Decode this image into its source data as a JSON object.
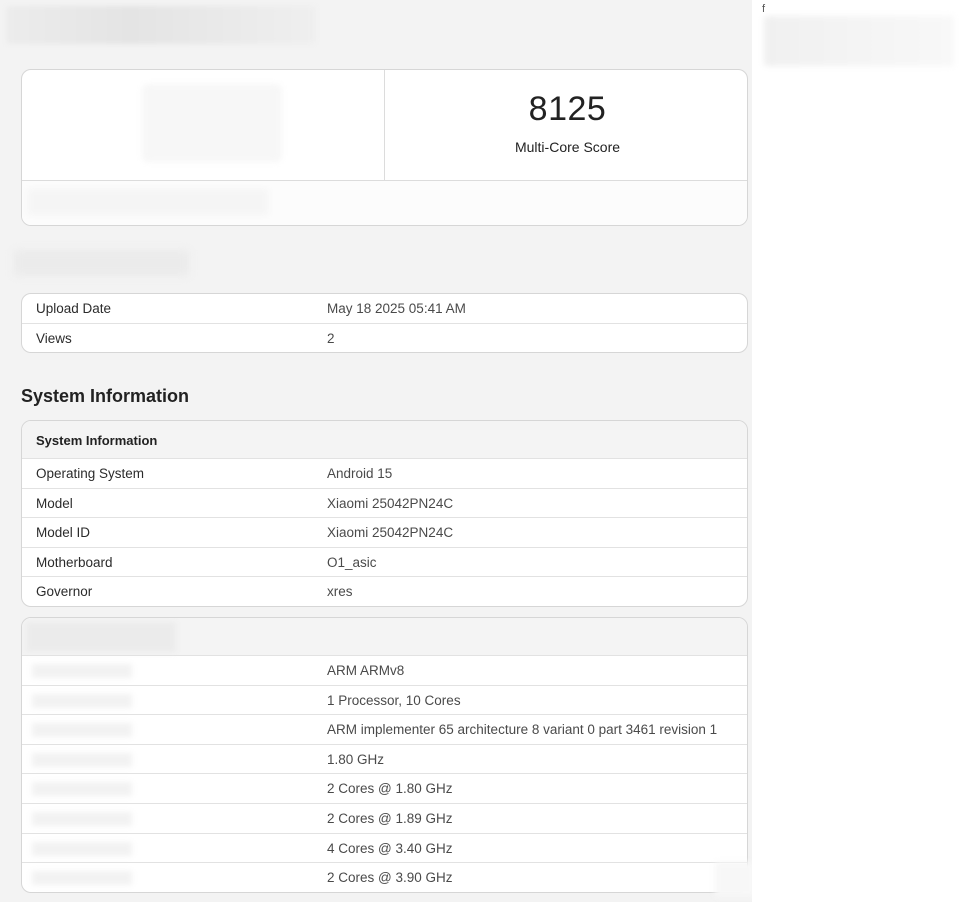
{
  "score": {
    "value": "8125",
    "label": "Multi-Core Score"
  },
  "meta": {
    "rows": [
      {
        "key": "Upload Date",
        "value": "May 18 2025 05:41 AM"
      },
      {
        "key": "Views",
        "value": "2"
      }
    ]
  },
  "system_information": {
    "section_title": "System Information",
    "card_title": "System Information",
    "rows": [
      {
        "key": "Operating System",
        "value": "Android 15"
      },
      {
        "key": "Model",
        "value": "Xiaomi 25042PN24C"
      },
      {
        "key": "Model ID",
        "value": "Xiaomi 25042PN24C"
      },
      {
        "key": "Motherboard",
        "value": "O1_asic"
      },
      {
        "key": "Governor",
        "value": "xres"
      }
    ]
  },
  "cpu_information": {
    "rows": [
      {
        "value": "ARM ARMv8"
      },
      {
        "value": "1 Processor, 10 Cores"
      },
      {
        "value": "ARM implementer 65 architecture 8 variant 0 part 3461 revision 1"
      },
      {
        "value": "1.80 GHz"
      },
      {
        "value": "2 Cores @ 1.80 GHz"
      },
      {
        "value": "2 Cores @ 1.89 GHz"
      },
      {
        "value": "4 Cores @ 3.40 GHz"
      },
      {
        "value": "2 Cores @ 3.90 GHz"
      }
    ]
  },
  "sidebar": {
    "mark": "f"
  }
}
